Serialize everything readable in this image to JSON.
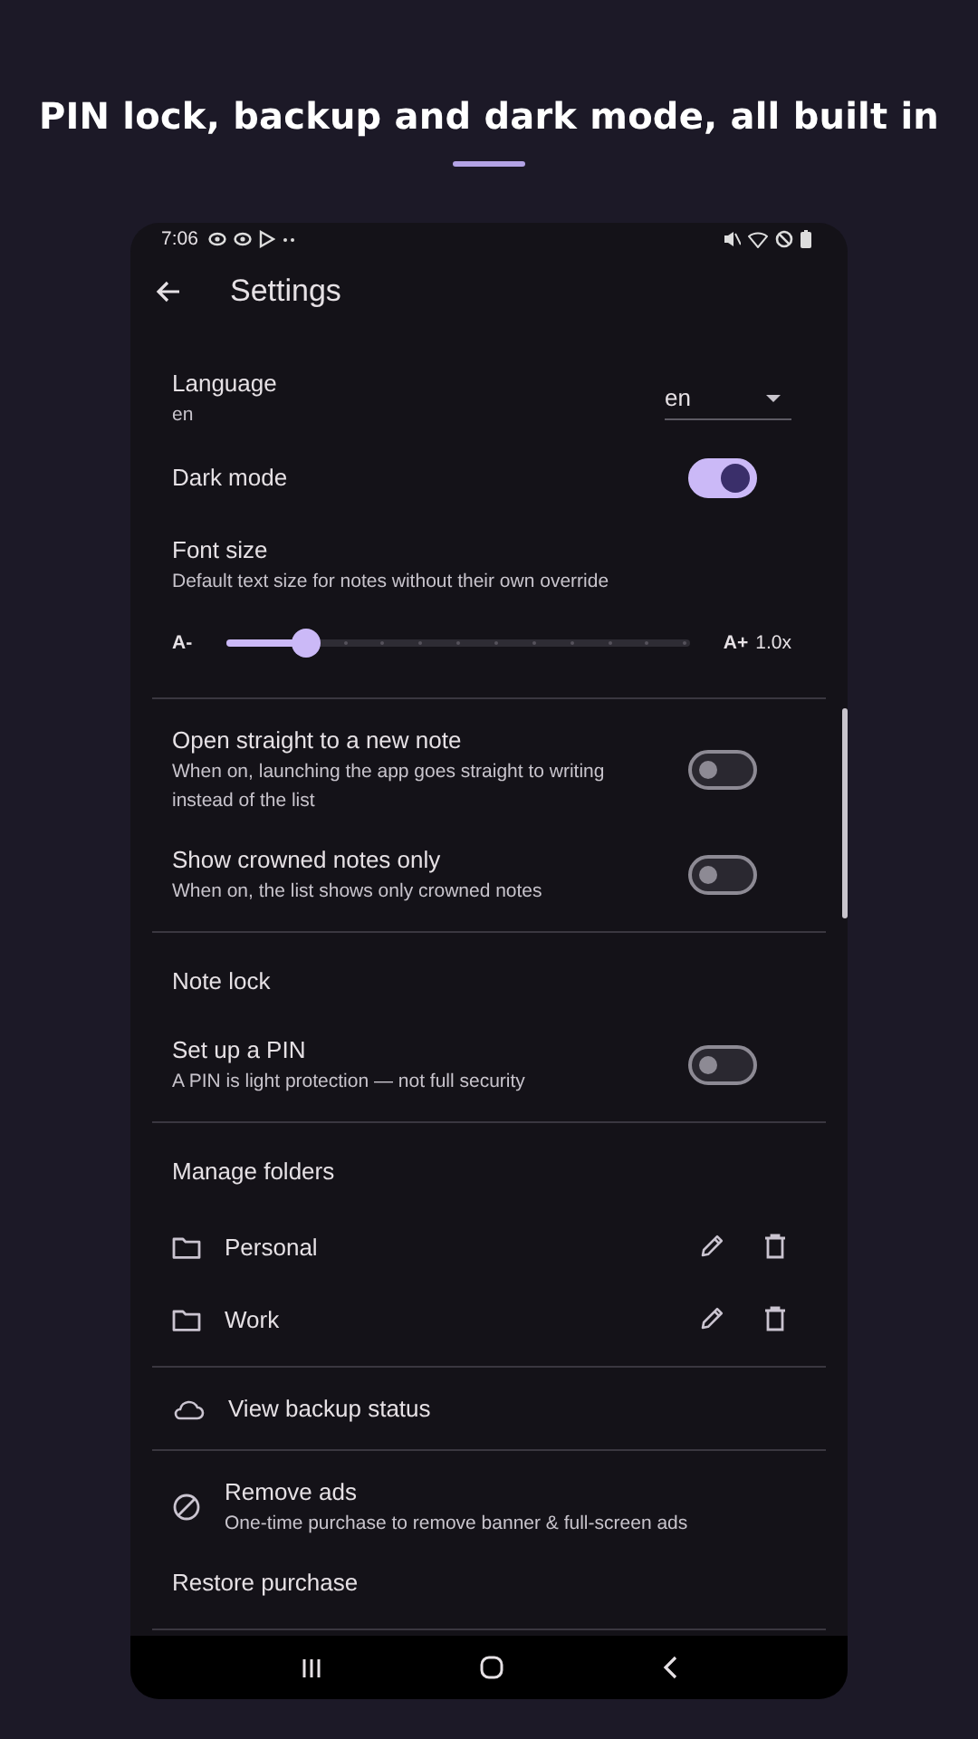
{
  "headline": "PIN lock, backup and dark mode, all built in",
  "status_bar": {
    "time": "7:06"
  },
  "app_bar": {
    "title": "Settings"
  },
  "sections": [
    {
      "items": [
        {
          "kind": "dropdown",
          "title": "Language",
          "subtitle": "en",
          "value": "en"
        },
        {
          "kind": "switch",
          "title": "Dark mode",
          "on": true
        },
        {
          "kind": "slider",
          "title": "Font size",
          "subtitle": "Default text size for notes without their own override",
          "min_label": "A-",
          "max_label": "A+",
          "reading": "1.0x",
          "level": 0.17
        }
      ]
    },
    {
      "items": [
        {
          "kind": "switch",
          "title": "Open straight to a new note",
          "subtitle": "When on, launching the app goes straight to writing instead of the list",
          "on": false
        },
        {
          "kind": "switch",
          "title": "Show crowned notes only",
          "subtitle": "When on, the list shows only crowned notes",
          "on": false
        }
      ]
    },
    {
      "items": [
        {
          "kind": "header",
          "title": "Note lock"
        },
        {
          "kind": "switch",
          "title": "Set up a PIN",
          "subtitle": "A PIN is light protection — not full security",
          "on": false
        }
      ]
    },
    {
      "items": [
        {
          "kind": "header",
          "title": "Manage folders"
        },
        {
          "kind": "folder",
          "title": "Personal"
        },
        {
          "kind": "folder",
          "title": "Work"
        }
      ]
    },
    {
      "items": [
        {
          "kind": "cloud",
          "title": "View backup status"
        }
      ]
    },
    {
      "items": [
        {
          "kind": "noads",
          "title": "Remove ads",
          "subtitle": "One-time purchase to remove banner & full-screen ads"
        },
        {
          "kind": "plain",
          "title": "Restore purchase"
        }
      ]
    }
  ]
}
